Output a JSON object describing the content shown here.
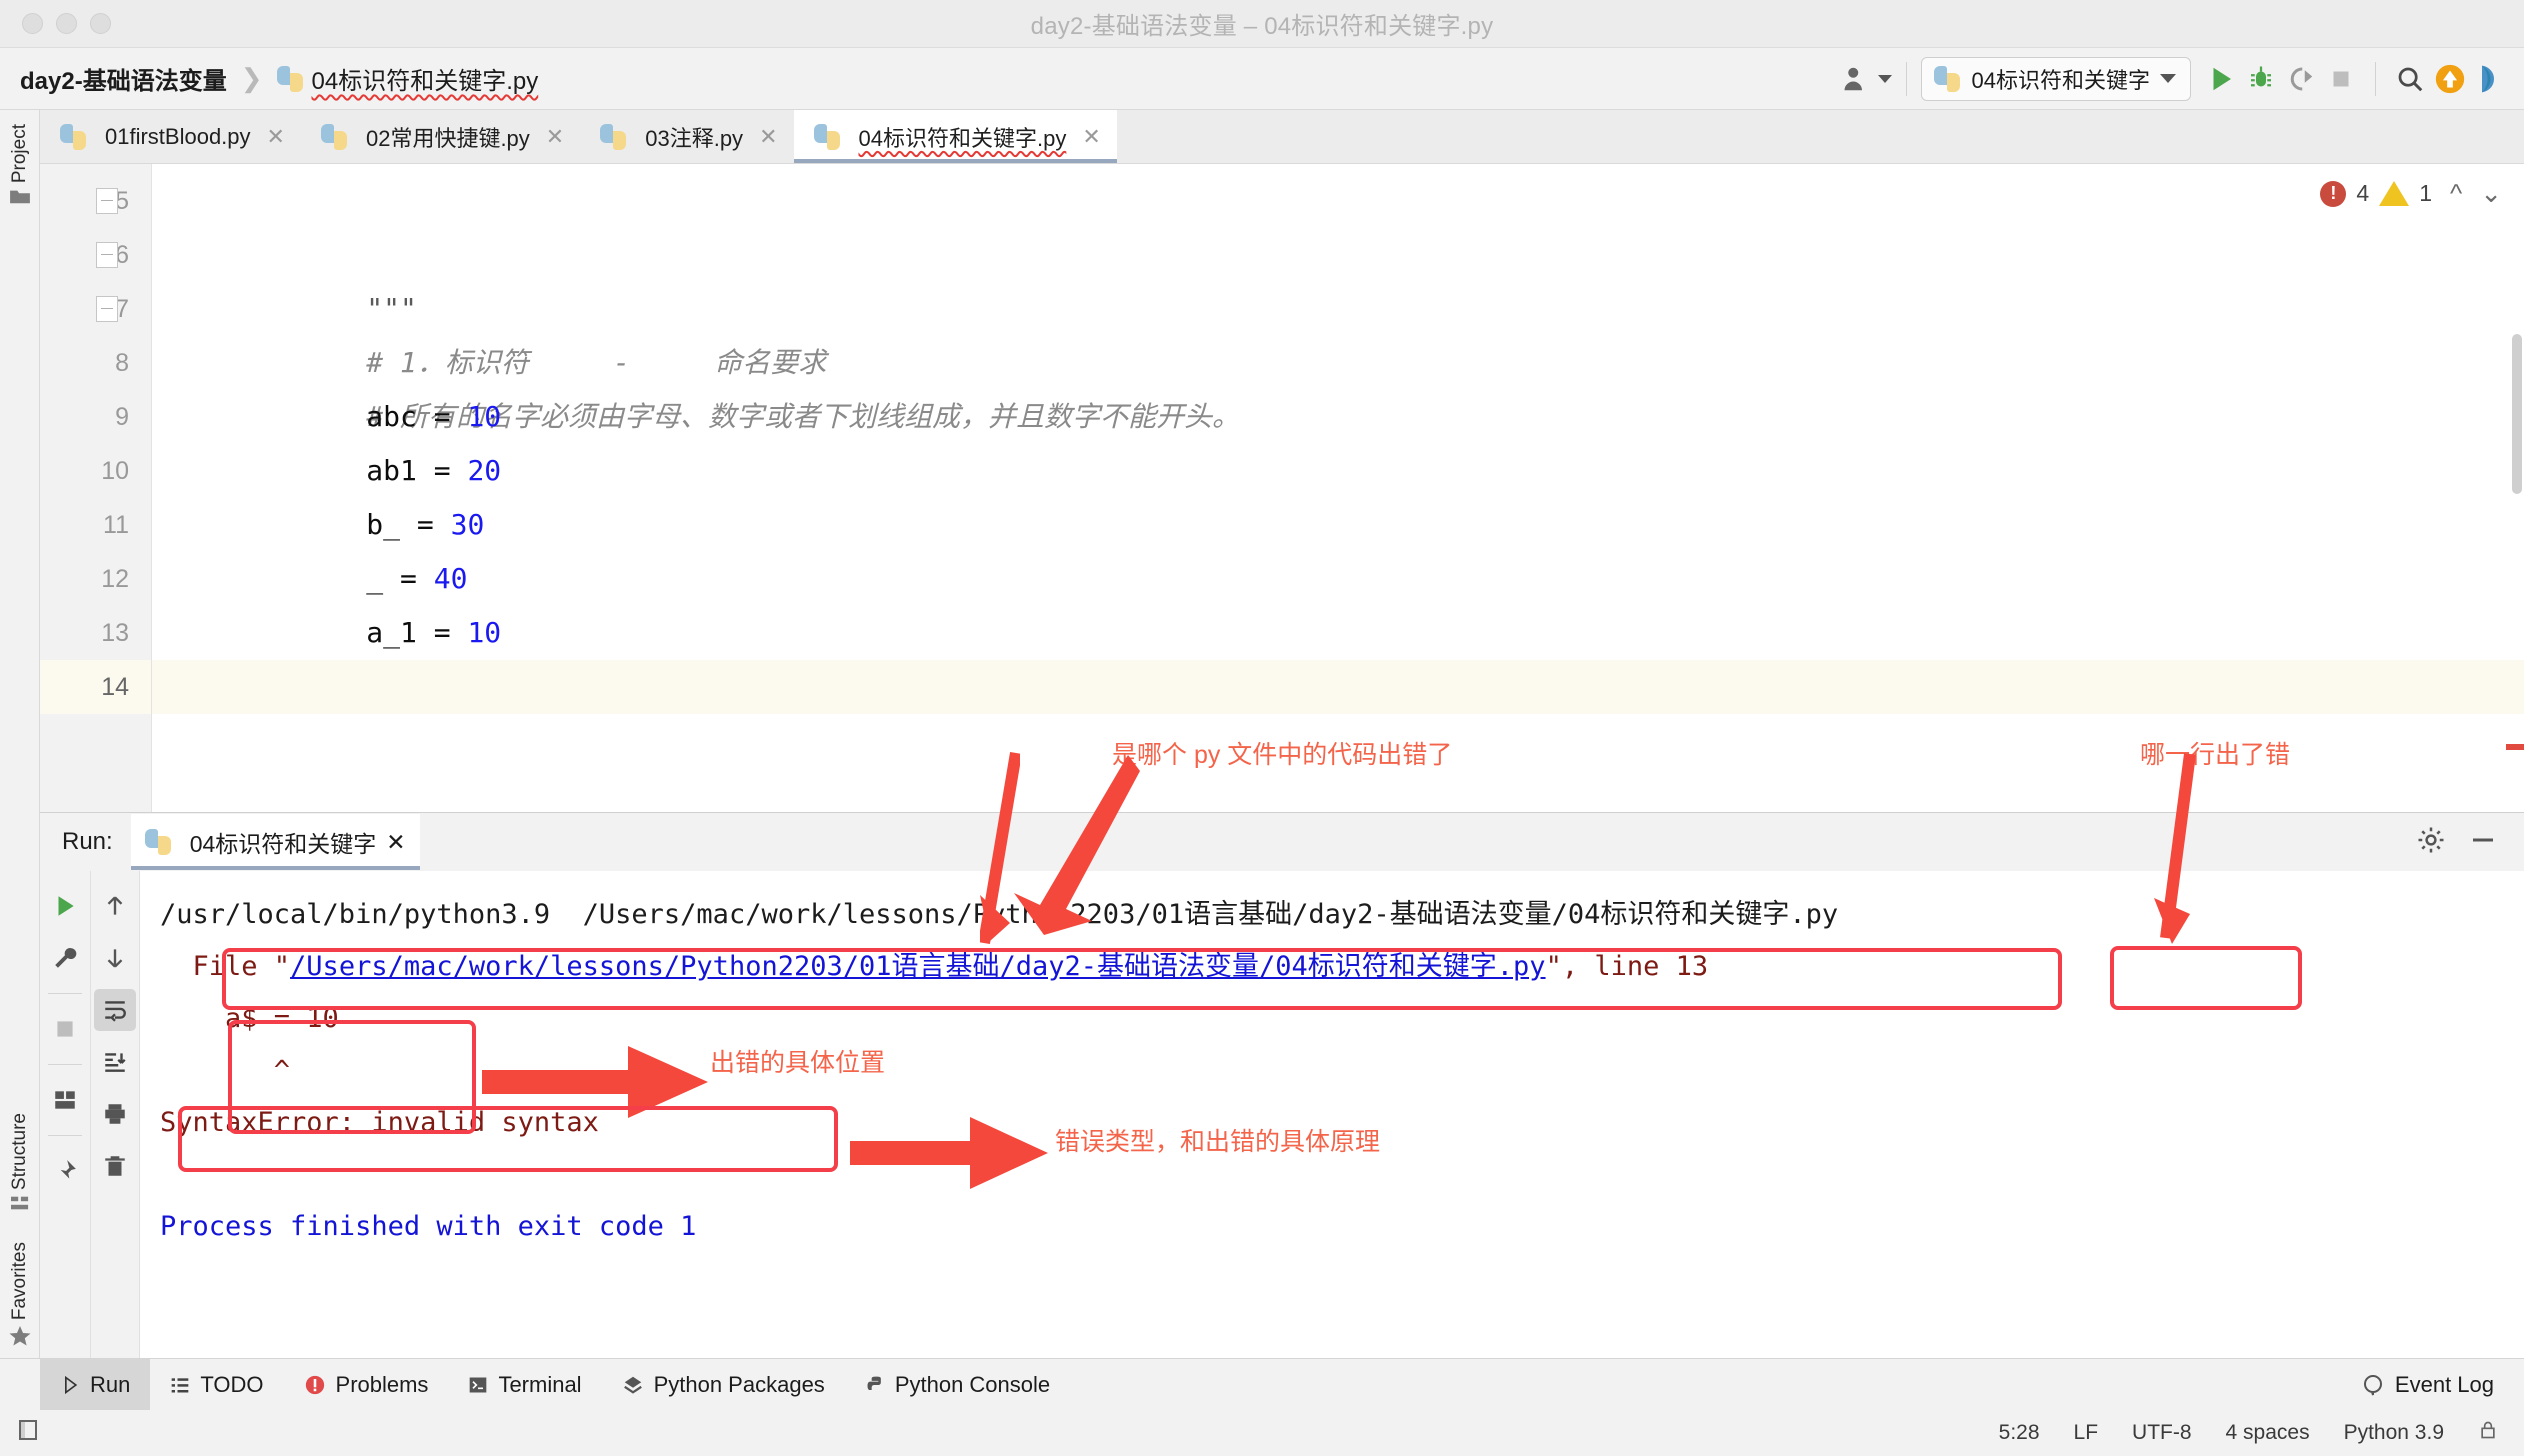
{
  "window": {
    "title": "day2-基础语法变量 – 04标识符和关键字.py"
  },
  "toolbar": {
    "breadcrumb_project": "day2-基础语法变量",
    "breadcrumb_sep": "❯",
    "breadcrumb_file": "04标识符和关键字.py",
    "run_config": "04标识符和关键字",
    "icons": {
      "user": "user-icon",
      "run": "run-icon",
      "debug": "debug-icon",
      "coverage": "coverage-icon",
      "stop": "stop-icon",
      "search": "search-icon",
      "update": "update-icon",
      "profile": "profile-icon"
    }
  },
  "left_strip": {
    "project": "Project",
    "structure": "Structure",
    "favorites": "Favorites"
  },
  "tabs": [
    {
      "label": "01firstBlood.py",
      "active": false,
      "error": false
    },
    {
      "label": "02常用快捷键.py",
      "active": false,
      "error": false
    },
    {
      "label": "03注释.py",
      "active": false,
      "error": false
    },
    {
      "label": "04标识符和关键字.py",
      "active": true,
      "error": true
    }
  ],
  "editor": {
    "inspection": {
      "errors": "4",
      "warnings": "1"
    },
    "lines": [
      {
        "no": "5",
        "segments": [
          {
            "t": "\"\"\"",
            "c": "str"
          }
        ],
        "fold": true,
        "current": false
      },
      {
        "no": "6",
        "segments": [
          {
            "t": "# 1．标识符     -     命名要求",
            "c": "cmt"
          }
        ],
        "fold": true,
        "current": false
      },
      {
        "no": "7",
        "segments": [
          {
            "t": "# 所有的名字必须由字母、数字或者下划线组成，并且数字不能开头。",
            "c": "cmt"
          }
        ],
        "fold": true,
        "current": false
      },
      {
        "no": "8",
        "segments": [
          {
            "t": "abc = ",
            "c": ""
          },
          {
            "t": "10",
            "c": "num"
          }
        ],
        "fold": false,
        "current": false
      },
      {
        "no": "9",
        "segments": [
          {
            "t": "ab1 = ",
            "c": ""
          },
          {
            "t": "20",
            "c": "num"
          }
        ],
        "fold": false,
        "current": false
      },
      {
        "no": "10",
        "segments": [
          {
            "t": "b_ = ",
            "c": ""
          },
          {
            "t": "30",
            "c": "num"
          }
        ],
        "fold": false,
        "current": false
      },
      {
        "no": "11",
        "segments": [
          {
            "t": "_ = ",
            "c": ""
          },
          {
            "t": "40",
            "c": "num"
          }
        ],
        "fold": false,
        "current": false
      },
      {
        "no": "12",
        "segments": [
          {
            "t": "a_1 = ",
            "c": ""
          },
          {
            "t": "10",
            "c": "num"
          }
        ],
        "fold": false,
        "current": false
      },
      {
        "no": "13",
        "segments": [
          {
            "t": "a",
            "c": ""
          },
          {
            "t": "$",
            "c": "err-tok"
          },
          {
            "t": " = ",
            "c": ""
          },
          {
            "t": "10",
            "c": "num warn-tok"
          }
        ],
        "fold": false,
        "current": false
      },
      {
        "no": "14",
        "segments": [
          {
            "t": "",
            "c": ""
          }
        ],
        "fold": false,
        "current": true
      }
    ]
  },
  "run_panel": {
    "label": "Run:",
    "tab": "04标识符和关键字",
    "tools_left": [
      "run-icon",
      "wrench-icon",
      "stop-icon",
      "layout-icon",
      "pin-icon"
    ],
    "tools_right": [
      "arrow-up-icon",
      "arrow-down-icon",
      "soft-wrap-icon",
      "scroll-end-icon",
      "print-icon",
      "trash-icon"
    ],
    "console": {
      "line_cmd": "/usr/local/bin/python3.9  /Users/mac/work/lessons/Python2203/01语言基础/day2-基础语法变量/04标识符和关键字.py",
      "line_file_prefix": "  File \"",
      "line_file_link": "/Users/mac/work/lessons/Python2203/01语言基础/day2-基础语法变量/04标识符和关键字.py",
      "line_file_suffix": "\", ",
      "line_file_lineno": "line 13",
      "line_code": "    a$ = 10",
      "line_caret": "       ^",
      "line_error": "SyntaxError: invalid syntax",
      "line_finished": "Process finished with exit code 1"
    }
  },
  "annotations": [
    {
      "id": "which-file",
      "text": "是哪个 py 文件中的代码出错了"
    },
    {
      "id": "which-line",
      "text": "哪一行出了错"
    },
    {
      "id": "error-location",
      "text": "出错的具体位置"
    },
    {
      "id": "error-type",
      "text": "错误类型，和出错的具体原理"
    }
  ],
  "status_bar": {
    "items": [
      {
        "label": "Run",
        "icon": "play-icon",
        "active": true
      },
      {
        "label": "TODO",
        "icon": "list-icon",
        "active": false
      },
      {
        "label": "Problems",
        "icon": "problems-icon",
        "active": false
      },
      {
        "label": "Terminal",
        "icon": "terminal-icon",
        "active": false
      },
      {
        "label": "Python Packages",
        "icon": "packages-icon",
        "active": false
      },
      {
        "label": "Python Console",
        "icon": "python-icon",
        "active": false
      }
    ],
    "event_log": "Event Log"
  },
  "info_bar": {
    "caret": "5:28",
    "line_sep": "LF",
    "encoding": "UTF-8",
    "indent": "4 spaces",
    "interpreter": "Python 3.9"
  },
  "colors": {
    "accent_red": "#f43f4a",
    "anno_text": "#f4644a",
    "link_blue": "#1414d6",
    "error_dark_red": "#7d1a13",
    "number_blue": "#1a1af0"
  }
}
